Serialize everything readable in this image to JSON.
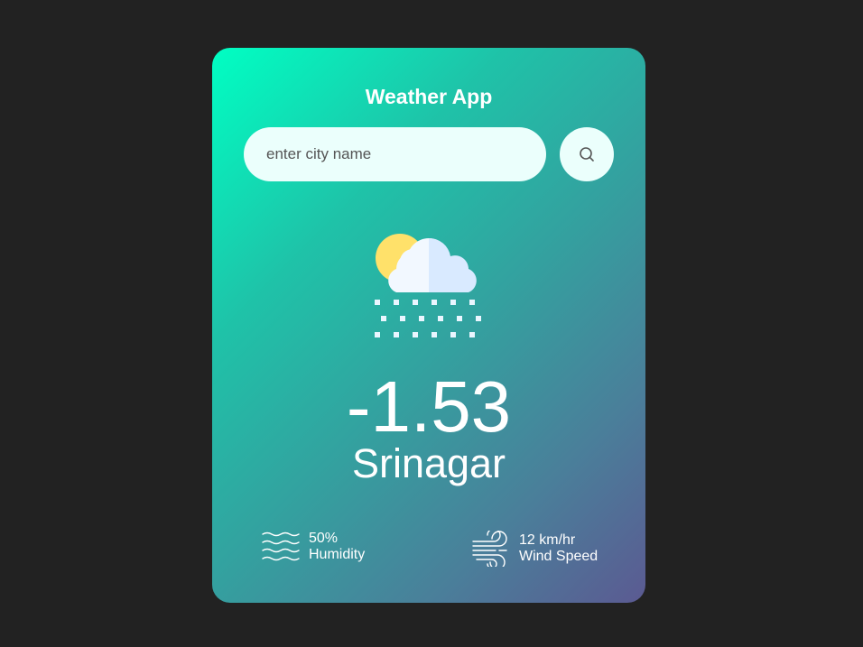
{
  "app": {
    "title": "Weather App"
  },
  "search": {
    "placeholder": "enter city name",
    "value": "",
    "button_icon": "search-icon"
  },
  "weather": {
    "icon": "snow-cloud-sun-icon",
    "temperature": "-1.53",
    "city": "Srinagar"
  },
  "details": {
    "humidity": {
      "icon": "humidity-waves-icon",
      "value": "50%",
      "label": "Humidity"
    },
    "wind": {
      "icon": "wind-icon",
      "value": "12 km/hr",
      "label": "Wind Speed"
    }
  },
  "colors": {
    "page_background": "#222222",
    "card_gradient_start": "#00ffc3",
    "card_gradient_end": "#5b5a92",
    "input_background": "#ebfffc",
    "text": "#ffffff"
  }
}
